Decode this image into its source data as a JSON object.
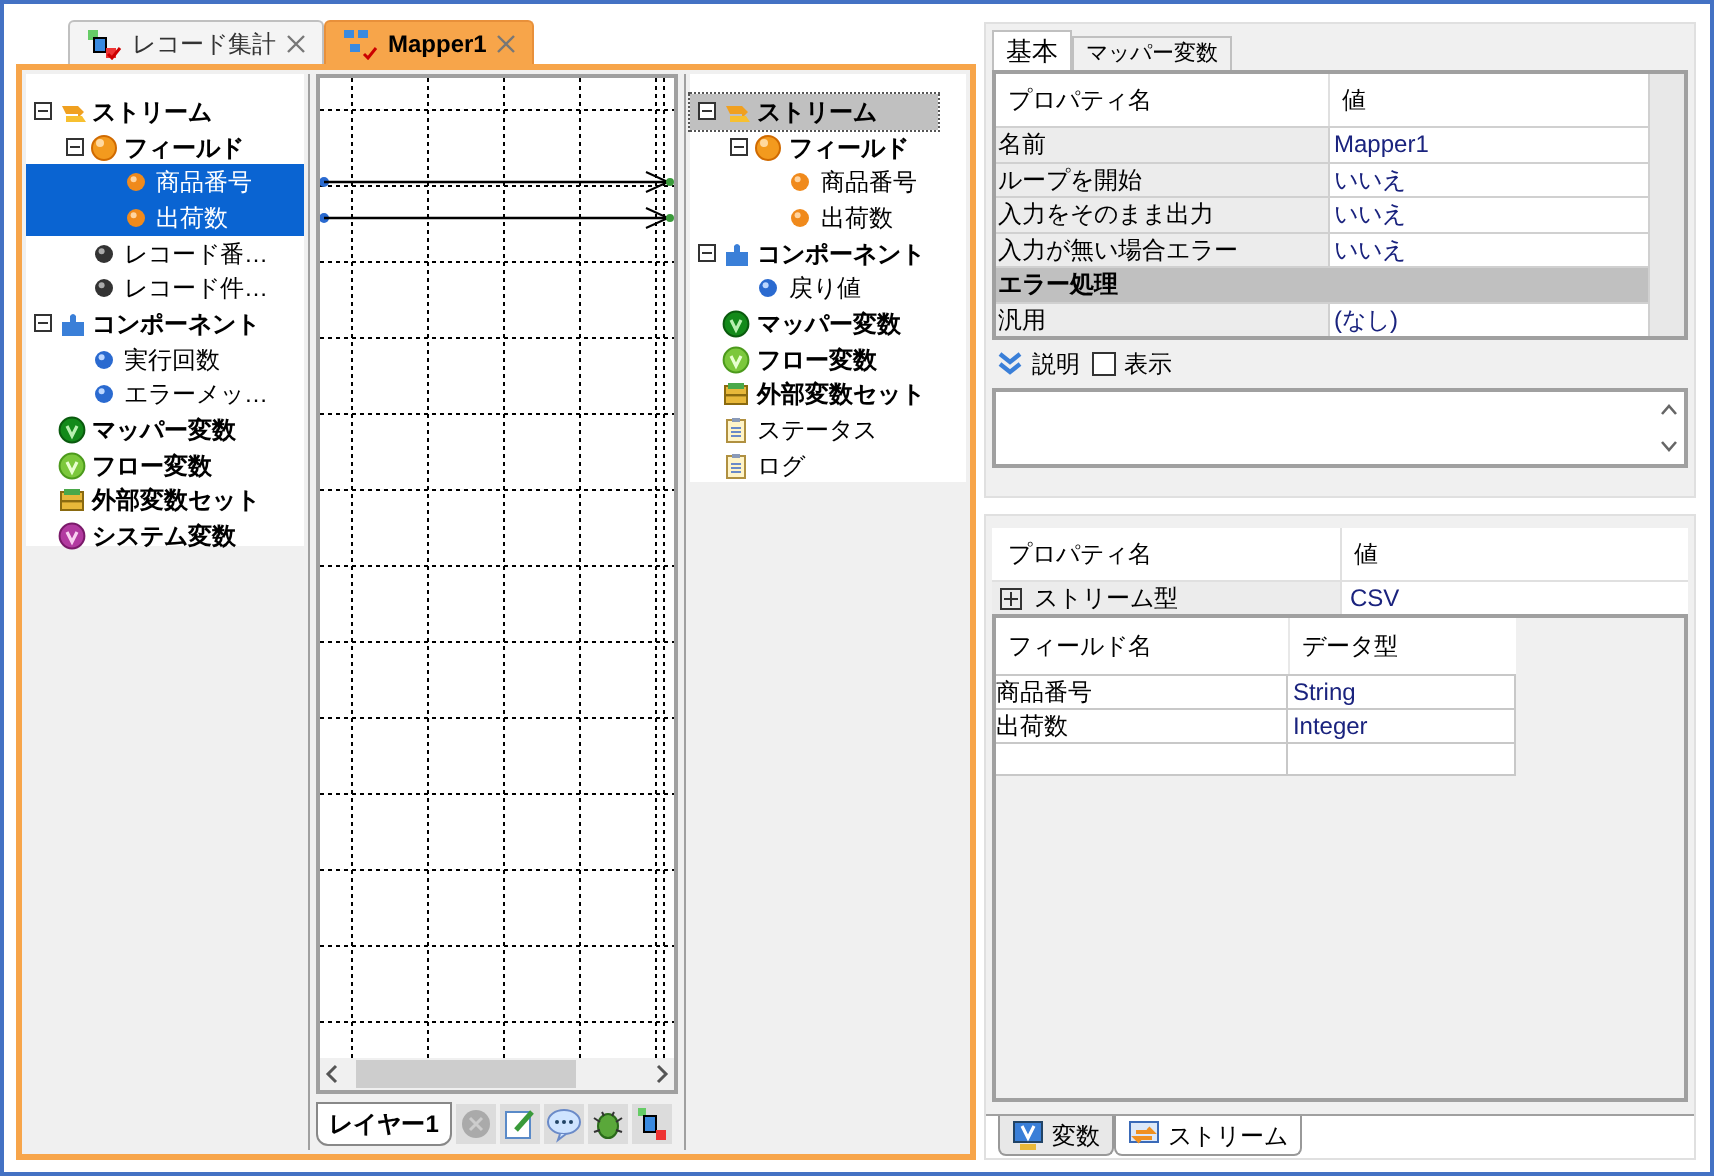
{
  "editor_tabs": [
    {
      "label": "レコード集計",
      "kind": "diagram",
      "selected": false
    },
    {
      "label": "Mapper1",
      "kind": "mapper",
      "selected": true
    }
  ],
  "input_tree": {
    "active": true,
    "items": [
      {
        "label": "ストリーム",
        "kind": "stream",
        "bold": true,
        "expanded": true,
        "selected": false,
        "children": [
          {
            "label": "フィールド",
            "kind": "field",
            "bold": true,
            "expanded": true,
            "selected": false,
            "children": [
              {
                "label": "商品番号",
                "kind": "orange-dot",
                "bold": false,
                "selected": true
              },
              {
                "label": "出荷数",
                "kind": "orange-dot",
                "bold": false,
                "selected": true
              }
            ]
          },
          {
            "label": "レコード番…",
            "kind": "black-dot",
            "bold": false,
            "selected": false
          },
          {
            "label": "レコード件…",
            "kind": "black-dot",
            "bold": false,
            "selected": false
          }
        ]
      },
      {
        "label": "コンポーネント",
        "kind": "component",
        "bold": true,
        "expanded": true,
        "selected": false,
        "children": [
          {
            "label": "実行回数",
            "kind": "blue-dot",
            "bold": false,
            "selected": false
          },
          {
            "label": "エラーメッ…",
            "kind": "blue-dot",
            "bold": false,
            "selected": false
          }
        ]
      },
      {
        "label": "マッパー変数",
        "kind": "mapper-var",
        "bold": true,
        "selected": false
      },
      {
        "label": "フロー変数",
        "kind": "flow-var",
        "bold": true,
        "selected": false
      },
      {
        "label": "外部変数セット",
        "kind": "chest",
        "bold": true,
        "selected": false
      },
      {
        "label": "システム変数",
        "kind": "system-var",
        "bold": true,
        "selected": false
      }
    ]
  },
  "output_tree": {
    "active": false,
    "items": [
      {
        "label": "ストリーム",
        "kind": "stream",
        "bold": true,
        "expanded": true,
        "selected": true,
        "children": [
          {
            "label": "フィールド",
            "kind": "field",
            "bold": true,
            "expanded": true,
            "selected": false,
            "children": [
              {
                "label": "商品番号",
                "kind": "orange-dot",
                "bold": false,
                "selected": false
              },
              {
                "label": "出荷数",
                "kind": "orange-dot",
                "bold": false,
                "selected": false
              }
            ]
          }
        ]
      },
      {
        "label": "コンポーネント",
        "kind": "component",
        "bold": true,
        "expanded": true,
        "selected": false,
        "children": [
          {
            "label": "戻り値",
            "kind": "blue-dot",
            "bold": false,
            "selected": false
          }
        ]
      },
      {
        "label": "マッパー変数",
        "kind": "mapper-var",
        "bold": true,
        "selected": false
      },
      {
        "label": "フロー変数",
        "kind": "flow-var",
        "bold": true,
        "selected": false
      },
      {
        "label": "外部変数セット",
        "kind": "chest",
        "bold": true,
        "selected": false
      },
      {
        "label": "ステータス",
        "kind": "doc",
        "bold": false,
        "selected": false
      },
      {
        "label": "ログ",
        "kind": "doc",
        "bold": false,
        "selected": false
      }
    ]
  },
  "layer_tabs": [
    {
      "label": "レイヤー1",
      "selected": true
    }
  ],
  "properties": {
    "tabs": [
      {
        "label": "基本",
        "selected": true
      },
      {
        "label": "マッパー変数",
        "selected": false
      }
    ],
    "columns": [
      "プロパティ名",
      "値"
    ],
    "rows": [
      {
        "kind": "property",
        "name": "名前",
        "value": "Mapper1"
      },
      {
        "kind": "property",
        "name": "ループを開始",
        "value": "いいえ"
      },
      {
        "kind": "property",
        "name": "入力をそのまま出力",
        "value": "いいえ"
      },
      {
        "kind": "property",
        "name": "入力が無い場合エラー",
        "value": "いいえ"
      },
      {
        "kind": "category",
        "name": "エラー処理"
      },
      {
        "kind": "property",
        "name": "汎用",
        "value": "(なし)"
      }
    ],
    "description": {
      "label": "説明",
      "checkbox_label": "表示",
      "checked": false
    }
  },
  "stream_properties": {
    "columns": [
      "プロパティ名",
      "値"
    ],
    "rows": [
      {
        "name": "ストリーム型",
        "value": "CSV",
        "expanded": false
      }
    ],
    "fields": {
      "columns": [
        "フィールド名",
        "データ型"
      ],
      "rows": [
        [
          "商品番号",
          "String"
        ],
        [
          "出荷数",
          "Integer"
        ]
      ]
    }
  },
  "bottom_tabs": [
    {
      "label": "変数",
      "kind": "variable",
      "selected": false
    },
    {
      "label": "ストリーム",
      "kind": "stream-panel",
      "selected": true
    }
  ]
}
